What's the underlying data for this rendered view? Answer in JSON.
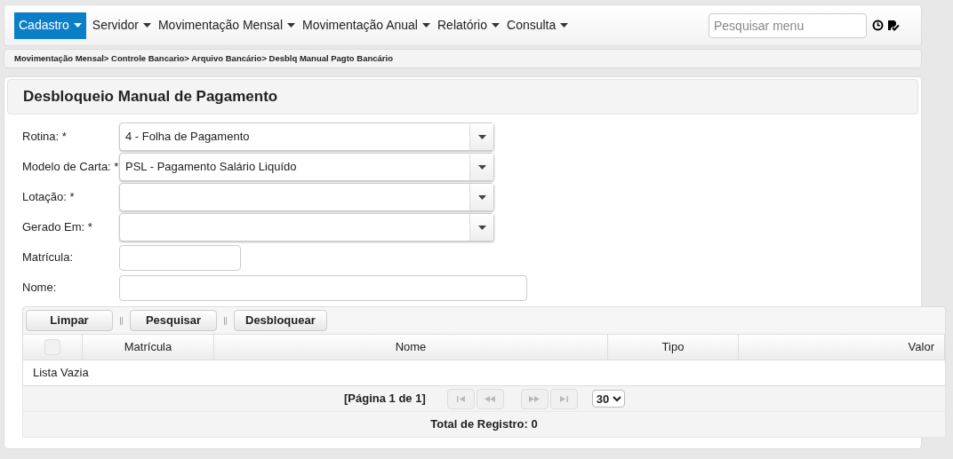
{
  "menu": [
    {
      "label": "Cadastro",
      "selected": true
    },
    {
      "label": "Servidor",
      "selected": false
    },
    {
      "label": "Movimentação Mensal",
      "selected": false
    },
    {
      "label": "Movimentação Anual",
      "selected": false
    },
    {
      "label": "Relatório",
      "selected": false
    },
    {
      "label": "Consulta",
      "selected": false
    }
  ],
  "search": {
    "placeholder": "Pesquisar menu"
  },
  "breadcrumb": "Movimentação Mensal> Controle Bancario> Arquivo Bancário> Desblq Manual Pagto Bancário",
  "title": "Desbloqueio Manual de Pagamento",
  "fields": [
    {
      "kind": "select",
      "label": "Rotina: *",
      "value": "4 - Folha de Pagamento"
    },
    {
      "kind": "select",
      "label": "Modelo de Carta: *",
      "value": "PSL - Pagamento Salário Liquído"
    },
    {
      "kind": "select",
      "label": "Lotação: *"
    },
    {
      "kind": "select",
      "label": "Gerado Em: *"
    },
    {
      "kind": "short",
      "label": "Matrícula:"
    },
    {
      "kind": "long",
      "label": "Nome:"
    }
  ],
  "buttons": [
    "Limpar",
    "Pesquisar",
    "Desbloquear"
  ],
  "table": {
    "select_all": {
      "checked": false
    },
    "columns": [
      "Matrícula",
      "Nome",
      "Tipo",
      "Valor"
    ],
    "empty_message": "Lista Vazia",
    "pager": "[Página 1 de 1]",
    "page_size": "30",
    "total": "Total de Registro: 0"
  }
}
